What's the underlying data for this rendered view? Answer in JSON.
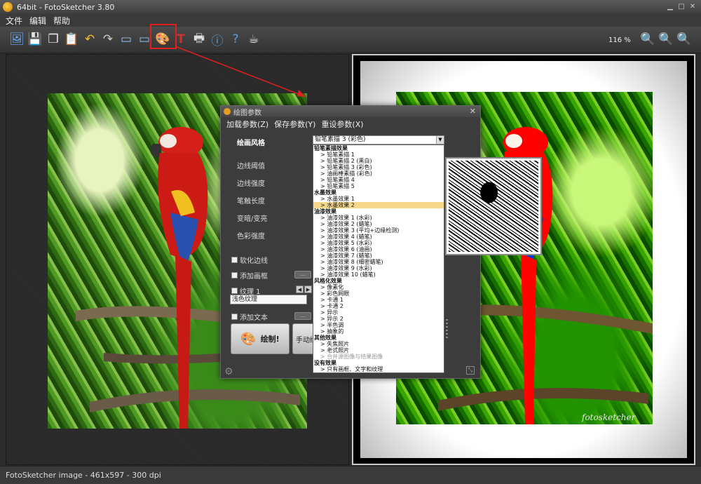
{
  "window": {
    "title": "64bit - FotoSketcher 3.80"
  },
  "menu": [
    "文件",
    "编辑",
    "帮助"
  ],
  "toolbar": {
    "icons": [
      "open-image-icon",
      "save-icon",
      "copy-icon",
      "paste-icon",
      "undo-icon",
      "redo-icon",
      "original-image-icon",
      "result-image-icon",
      "drawing-params-icon",
      "text-tool-icon",
      "print-icon",
      "info-icon",
      "help-icon",
      "coffee-icon"
    ],
    "zoom": "116 %",
    "zoom_icons": [
      "zoom-in-icon",
      "zoom-out-icon",
      "zoom-fit-icon"
    ]
  },
  "status": "FotoSketcher image - 461x597 - 300 dpi",
  "watermark": "fotosketcher",
  "dialog": {
    "title": "绘图参数",
    "menu": [
      "加载参数(Z)",
      "保存参数(Y)",
      "重设参数(X)"
    ],
    "style_label": "绘画风格",
    "style_value": "铅笔素描 3 (彩色)",
    "params": [
      "边线阈值",
      "边线强度",
      "笔触长度",
      "变暗/变亮",
      "色彩强度"
    ],
    "soften_edges": "软化边线",
    "add_frame": "添加画框",
    "texture": "纹理 1",
    "texture_value": "浅色纹理",
    "add_text": "添加文本",
    "draw_button": "绘制!",
    "manual_button": "手动绘制",
    "ellipsis": "..."
  },
  "dropdown": [
    {
      "type": "group",
      "text": "铅笔素描效果"
    },
    {
      "type": "item",
      "text": "> 铅笔素描 1"
    },
    {
      "type": "item",
      "text": "> 铅笔素描 2 (黑白)"
    },
    {
      "type": "item",
      "text": "> 铅笔素描 3 (彩色)"
    },
    {
      "type": "item",
      "text": "> 油画棒素描 (彩色)"
    },
    {
      "type": "item",
      "text": "> 铅笔素描 4"
    },
    {
      "type": "item",
      "text": "> 铅笔素描 5"
    },
    {
      "type": "group",
      "text": "水墨效果"
    },
    {
      "type": "item",
      "text": "> 水墨效果 1"
    },
    {
      "type": "item",
      "text": "> 水墨效果 2",
      "selected": true
    },
    {
      "type": "group",
      "text": "油漆效果"
    },
    {
      "type": "item",
      "text": "> 油漆效果 1 (水彩)"
    },
    {
      "type": "item",
      "text": "> 油漆效果 2 (蜡笔)"
    },
    {
      "type": "item",
      "text": "> 油漆效果 3 (平均+边缘检测)"
    },
    {
      "type": "item",
      "text": "> 油漆效果 4 (蜡笔)"
    },
    {
      "type": "item",
      "text": "> 油漆效果 5 (水彩)"
    },
    {
      "type": "item",
      "text": "> 油漆效果 6 (油画)"
    },
    {
      "type": "item",
      "text": "> 油漆效果 7 (蜡笔)"
    },
    {
      "type": "item",
      "text": "> 油漆效果 8 (细密蜡笔)"
    },
    {
      "type": "item",
      "text": "> 油漆效果 9 (水彩)"
    },
    {
      "type": "item",
      "text": "> 油漆效果 10 (蜡笔)"
    },
    {
      "type": "group",
      "text": "风格化效果"
    },
    {
      "type": "item",
      "text": "> 像素化"
    },
    {
      "type": "item",
      "text": "> 彩色网眼"
    },
    {
      "type": "item",
      "text": "> 卡通 1"
    },
    {
      "type": "item",
      "text": "> 卡通 2"
    },
    {
      "type": "item",
      "text": "> 异示"
    },
    {
      "type": "item",
      "text": "> 异示 2"
    },
    {
      "type": "item",
      "text": "> 半色调"
    },
    {
      "type": "item",
      "text": "> 抽象的"
    },
    {
      "type": "group",
      "text": "其他效果"
    },
    {
      "type": "item",
      "text": "> 失焦照片"
    },
    {
      "type": "item",
      "text": "> 老式照片"
    },
    {
      "type": "item",
      "text": "> 合并源图像与结果图像",
      "dim": true
    },
    {
      "type": "group",
      "text": "没有效果"
    },
    {
      "type": "item",
      "text": "> 只有画框、文字和纹理"
    }
  ]
}
